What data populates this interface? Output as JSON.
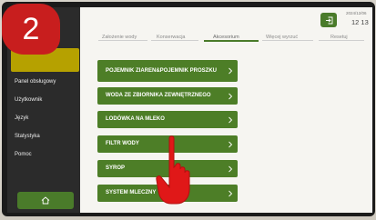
{
  "step_badge": "2",
  "sidebar": {
    "items": [
      {
        "label": "Panel obsługowy"
      },
      {
        "label": "Użytkownik"
      },
      {
        "label": "Język"
      },
      {
        "label": "Statystyka"
      },
      {
        "label": "Pomoc"
      }
    ],
    "home_icon": "home-icon"
  },
  "header": {
    "tabs": [
      {
        "label": "Założenie wody"
      },
      {
        "label": "Konserwacja"
      },
      {
        "label": "Akcesorium"
      },
      {
        "label": "Więcej wyrzuć"
      },
      {
        "label": "Resetuj"
      }
    ],
    "active_tab": "Akcesorium",
    "date": "2024/12/06",
    "time": "12 13",
    "logout_icon": "logout-icon"
  },
  "accessories": {
    "items": [
      {
        "label": "POJEMNIK ZIAREN&POJEMNIK PROSZKU"
      },
      {
        "label": "WODA ZE ZBIORNIKA ZEWNĘTRZNEGO"
      },
      {
        "label": "LODÓWKA NA MLEKO"
      },
      {
        "label": "FILTR WODY"
      },
      {
        "label": "SYROP"
      },
      {
        "label": "SYSTEM MLECZNY"
      }
    ]
  },
  "colors": {
    "accent_green": "#4d7e27",
    "sidebar_bg": "#2b2b2b",
    "active_sidebar": "#b6a100",
    "badge_red": "#c81e1e",
    "hand_red": "#e01818"
  }
}
